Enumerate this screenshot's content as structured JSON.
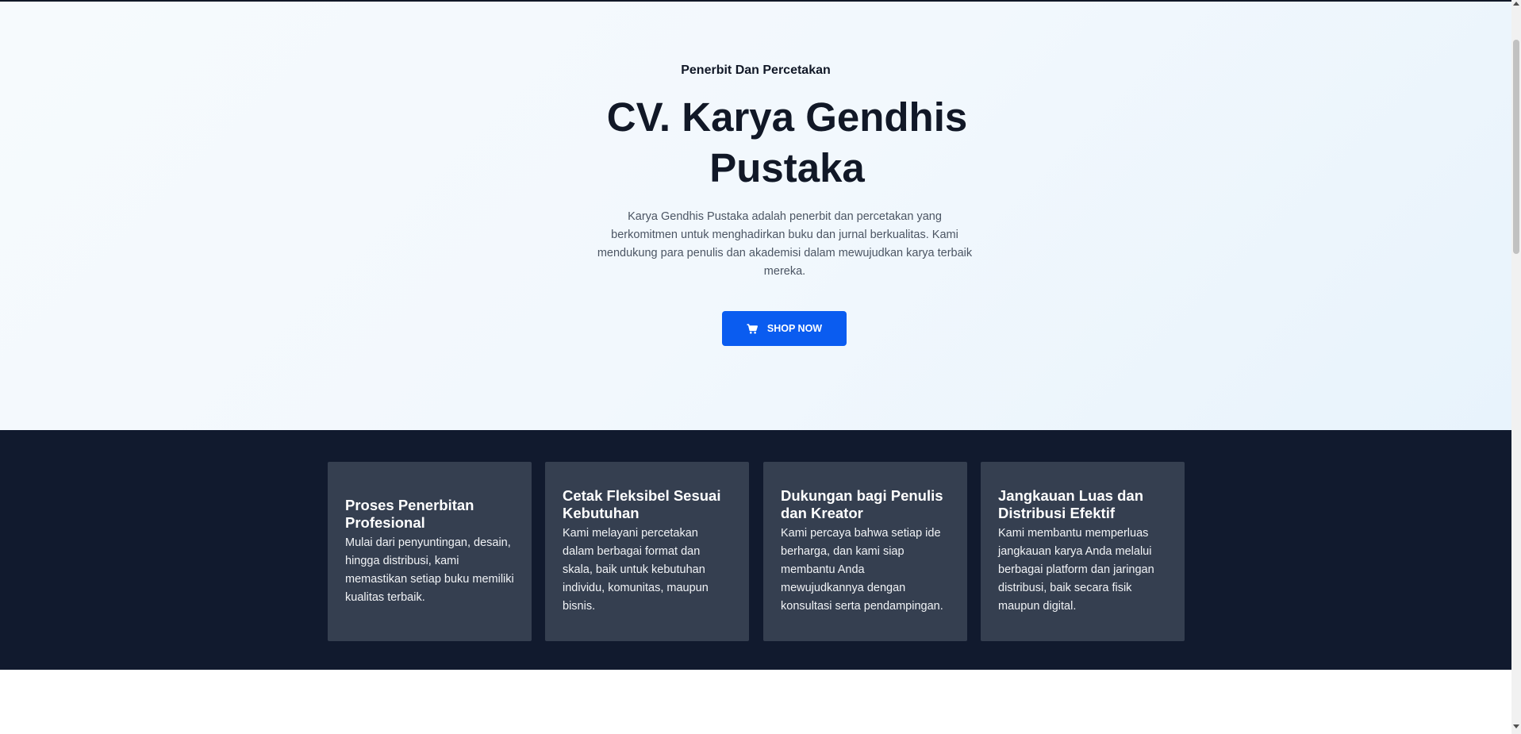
{
  "hero": {
    "eyebrow": "Penerbit Dan Percetakan",
    "title": "CV. Karya Gendhis Pustaka",
    "description": "Karya Gendhis Pustaka adalah penerbit dan percetakan yang berkomitmen untuk menghadirkan buku dan jurnal berkualitas. Kami mendukung para penulis dan akademisi dalam mewujudkan karya terbaik mereka.",
    "cta": {
      "label": "SHOP NOW",
      "icon": "shopping-cart-icon"
    }
  },
  "features": [
    {
      "title": "Proses Penerbitan Profesional",
      "text": "Mulai dari penyuntingan, desain, hingga distribusi, kami memastikan setiap buku memiliki kualitas terbaik."
    },
    {
      "title": "Cetak Fleksibel Sesuai Kebutuhan",
      "text": "Kami melayani percetakan dalam berbagai format dan skala, baik untuk kebutuhan individu, komunitas, maupun bisnis."
    },
    {
      "title": "Dukungan bagi Penulis dan Kreator",
      "text": "Kami percaya bahwa setiap ide berharga, dan kami siap membantu Anda mewujudkannya dengan konsultasi serta pendampingan."
    },
    {
      "title": "Jangkauan Luas dan Distribusi Efektif",
      "text": "Kami membantu memperluas jangkauan karya Anda melalui berbagai platform dan jaringan distribusi, baik secara fisik maupun digital."
    }
  ],
  "colors": {
    "accent": "#0a5cf0",
    "dark_section": "#111a2e",
    "card": "#353f50",
    "heading": "#111827"
  }
}
